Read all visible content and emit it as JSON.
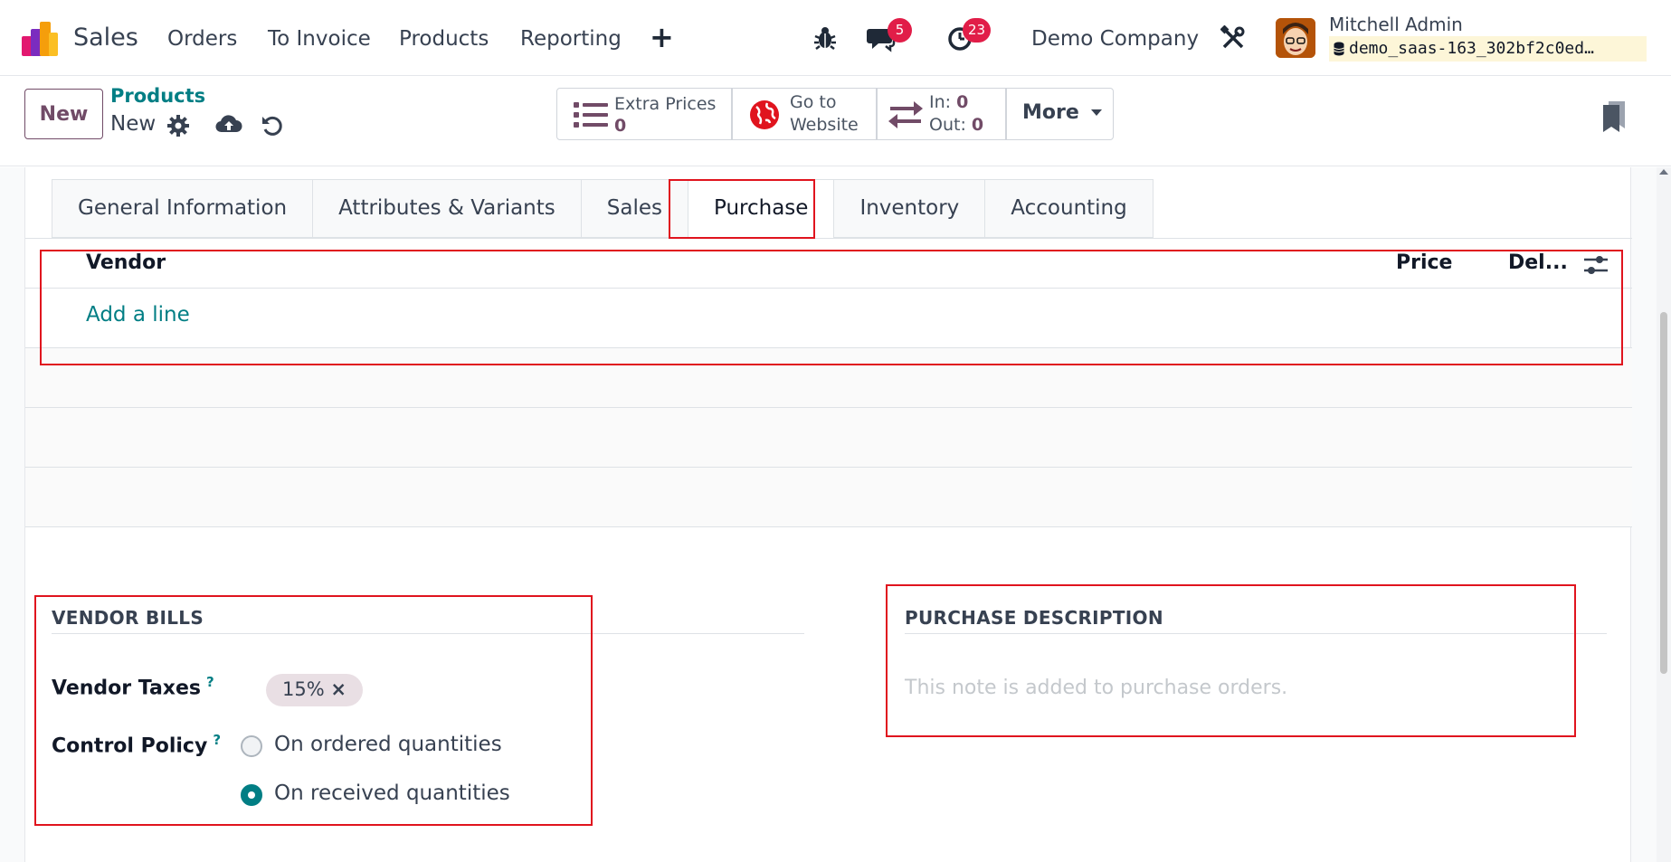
{
  "navbar": {
    "app_name": "Sales",
    "menus": [
      "Orders",
      "To Invoice",
      "Products",
      "Reporting"
    ],
    "plus_label": "+",
    "messages_count": "5",
    "activities_count": "23",
    "company": "Demo Company",
    "user_name": "Mitchell Admin",
    "database": "demo_saas-163_302bf2c0ed…"
  },
  "control_panel": {
    "new_label": "New",
    "breadcrumb_parent": "Products",
    "breadcrumb_current": "New",
    "extra_prices_label": "Extra Prices",
    "extra_prices_value": "0",
    "website_line1": "Go to",
    "website_line2": "Website",
    "in_label": "In:",
    "in_value": "0",
    "out_label": "Out:",
    "out_value": "0",
    "more_label": "More"
  },
  "tabs": [
    "General Information",
    "Attributes & Variants",
    "Sales",
    "Purchase",
    "Inventory",
    "Accounting"
  ],
  "active_tab": "Purchase",
  "vendor_list": {
    "headers": {
      "vendor": "Vendor",
      "price": "Price",
      "delivery": "Del..."
    },
    "add_line": "Add a line"
  },
  "vendor_bills": {
    "title": "VENDOR BILLS",
    "taxes_label": "Vendor Taxes",
    "taxes_help": "?",
    "tax_tag": "15%",
    "tax_tag_remove": "×",
    "policy_label": "Control Policy",
    "policy_help": "?",
    "policy_options": [
      "On ordered quantities",
      "On received quantities"
    ],
    "policy_selected": "On received quantities"
  },
  "purchase_description": {
    "title": "PURCHASE DESCRIPTION",
    "placeholder": "This note is added to purchase orders."
  },
  "colors": {
    "brand": "#714b67",
    "teal": "#017e84",
    "badge": "#e11d48",
    "highlight": "#e0141e"
  }
}
